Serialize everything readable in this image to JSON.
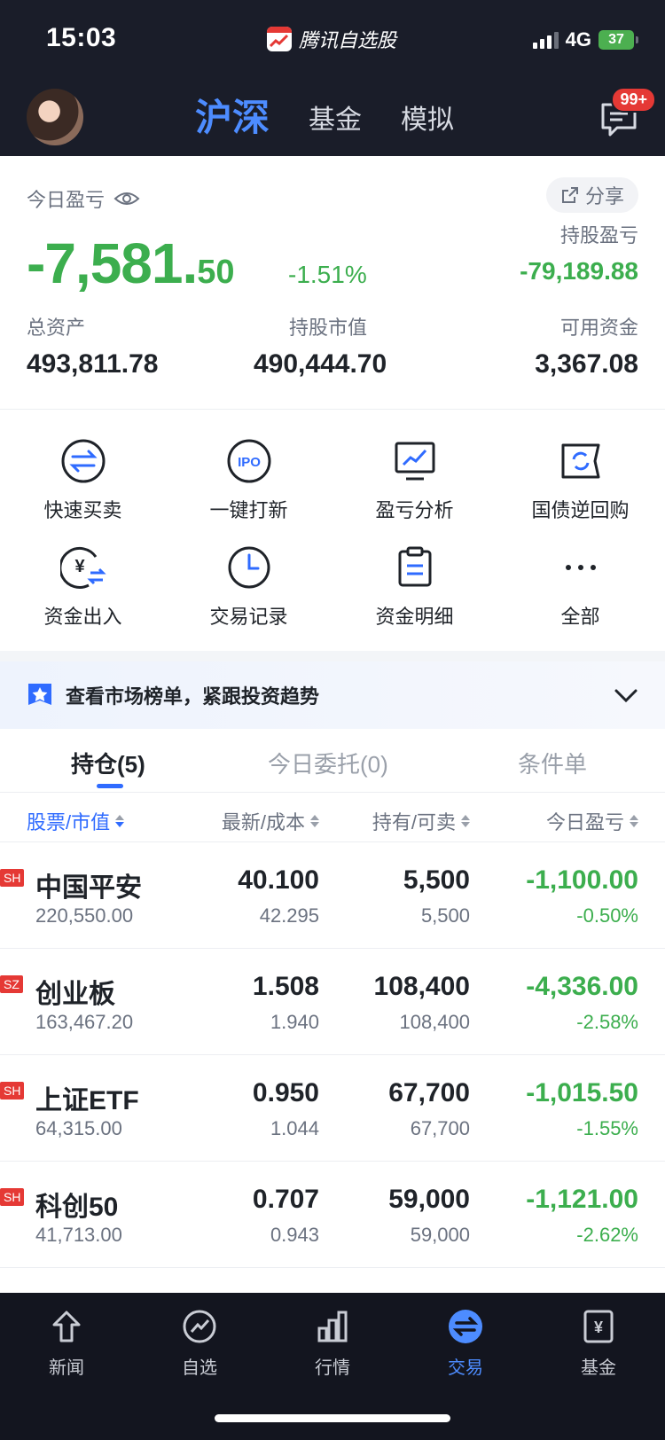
{
  "status_bar": {
    "time": "15:03",
    "app_name": "腾讯自选股",
    "network": "4G",
    "battery": "37"
  },
  "top_nav": {
    "tabs": [
      {
        "label": "沪深",
        "active": true
      },
      {
        "label": "基金",
        "active": false
      },
      {
        "label": "模拟",
        "active": false
      }
    ],
    "message_badge": "99+"
  },
  "summary": {
    "today_label": "今日盈亏",
    "share_label": "分享",
    "today_pnl_int": "-7,581.",
    "today_pnl_dec": "50",
    "today_pnl_pct": "-1.51%",
    "holding_pnl_label": "持股盈亏",
    "holding_pnl_value": "-79,189.88",
    "total_assets_label": "总资产",
    "total_assets_value": "493,811.78",
    "market_value_label": "持股市值",
    "market_value_value": "490,444.70",
    "available_cash_label": "可用资金",
    "available_cash_value": "3,367.08"
  },
  "actions": [
    {
      "label": "快速买卖",
      "icon": "swap-arrows-icon"
    },
    {
      "label": "一键打新",
      "icon": "ipo-icon"
    },
    {
      "label": "盈亏分析",
      "icon": "chart-monitor-icon"
    },
    {
      "label": "国债逆回购",
      "icon": "refresh-ticket-icon"
    },
    {
      "label": "资金出入",
      "icon": "yuan-transfer-icon"
    },
    {
      "label": "交易记录",
      "icon": "clock-icon"
    },
    {
      "label": "资金明细",
      "icon": "clipboard-icon"
    },
    {
      "label": "全部",
      "icon": "more-dots-icon"
    }
  ],
  "banner": {
    "text": "查看市场榜单，紧跟投资趋势"
  },
  "position_tabs": [
    {
      "label": "持仓(5)",
      "active": true
    },
    {
      "label": "今日委托(0)",
      "active": false
    },
    {
      "label": "条件单",
      "active": false
    }
  ],
  "table": {
    "headers": [
      "股票/市值",
      "最新/成本",
      "持有/可卖",
      "今日盈亏"
    ],
    "rows": [
      {
        "market": "SH",
        "name": "中国平安",
        "market_value": "220,550.00",
        "latest": "40.100",
        "cost": "42.295",
        "holding": "5,500",
        "sellable": "5,500",
        "pnl": "-1,100.00",
        "pnl_pct": "-0.50%"
      },
      {
        "market": "SZ",
        "name": "创业板",
        "market_value": "163,467.20",
        "latest": "1.508",
        "cost": "1.940",
        "holding": "108,400",
        "sellable": "108,400",
        "pnl": "-4,336.00",
        "pnl_pct": "-2.58%"
      },
      {
        "market": "SH",
        "name": "上证ETF",
        "market_value": "64,315.00",
        "latest": "0.950",
        "cost": "1.044",
        "holding": "67,700",
        "sellable": "67,700",
        "pnl": "-1,015.50",
        "pnl_pct": "-1.55%"
      },
      {
        "market": "SH",
        "name": "科创50",
        "market_value": "41,713.00",
        "latest": "0.707",
        "cost": "0.943",
        "holding": "59,000",
        "sellable": "59,000",
        "pnl": "-1,121.00",
        "pnl_pct": "-2.62%"
      }
    ]
  },
  "bottom_nav": [
    {
      "label": "新闻",
      "icon": "news-icon",
      "active": false
    },
    {
      "label": "自选",
      "icon": "watchlist-icon",
      "active": false
    },
    {
      "label": "行情",
      "icon": "market-bars-icon",
      "active": false
    },
    {
      "label": "交易",
      "icon": "trade-icon",
      "active": true
    },
    {
      "label": "基金",
      "icon": "fund-icon",
      "active": false
    }
  ],
  "colors": {
    "dark_bg": "#1a1d29",
    "accent_blue": "#2f6bff",
    "loss_green": "#3cae4e",
    "badge_red": "#e53935"
  }
}
